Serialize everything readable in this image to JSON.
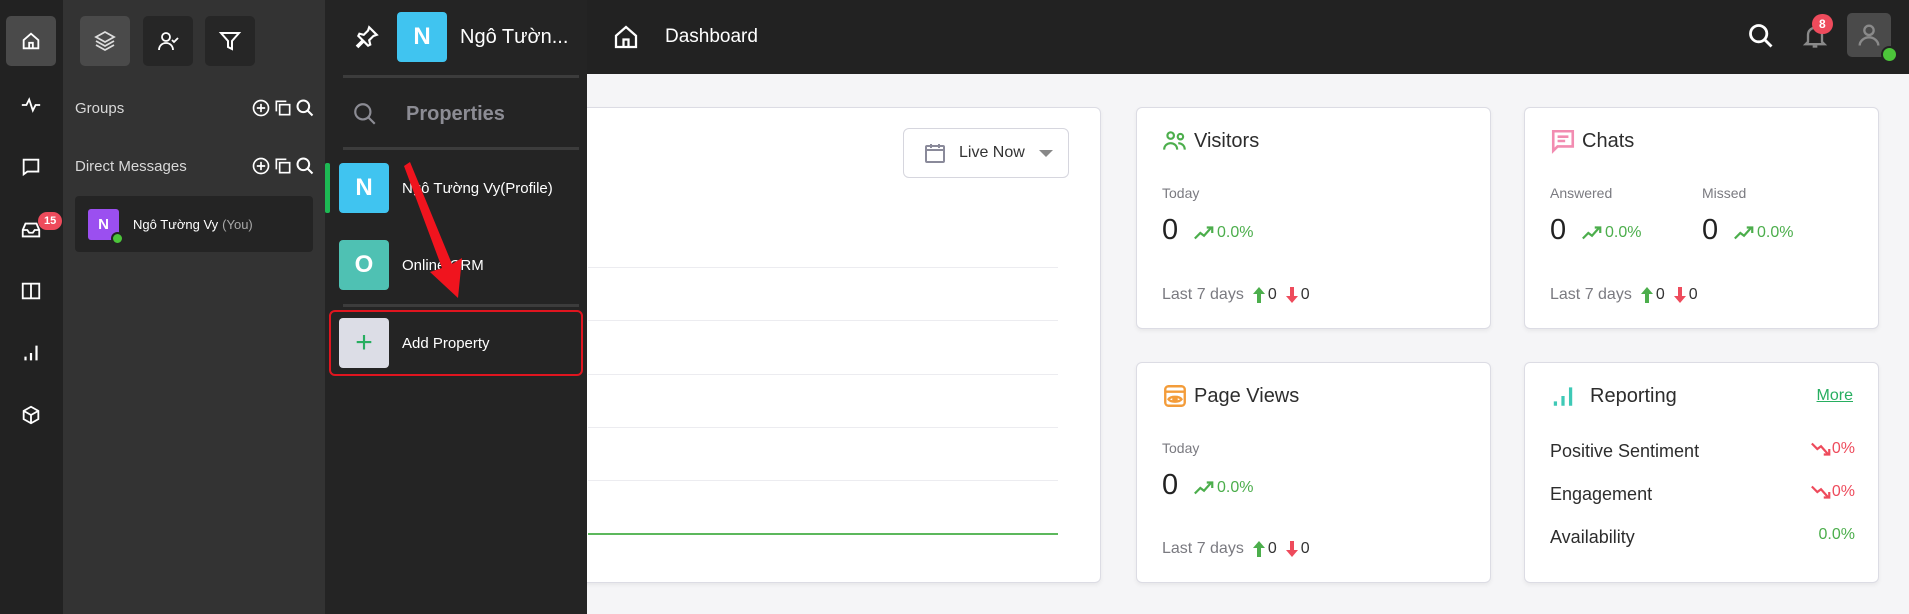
{
  "rail": {
    "items": [
      {
        "icon": "home-icon",
        "active": true
      },
      {
        "icon": "activity-icon"
      },
      {
        "icon": "chat-icon"
      },
      {
        "icon": "inbox-icon",
        "badge": "15"
      },
      {
        "icon": "book-icon"
      },
      {
        "icon": "bar-chart-icon"
      },
      {
        "icon": "package-icon"
      }
    ]
  },
  "panel": {
    "tools": [
      "layers-icon",
      "user-check-icon",
      "filter-icon"
    ],
    "groups_label": "Groups",
    "dm_label": "Direct Messages",
    "dm_item": {
      "initial": "N",
      "name": "Ngô Tường Vy",
      "suffix": "(You)"
    }
  },
  "popup": {
    "current": {
      "initial": "N",
      "name": "Ngô Tườn..."
    },
    "search_placeholder": "Properties",
    "properties": [
      {
        "initial": "N",
        "name": "Ngô Tường Vy(Profile)",
        "color": "#40c4f0",
        "selected": true
      },
      {
        "initial": "O",
        "name": "Online CRM",
        "color": "#4fc1b3",
        "selected": false
      }
    ],
    "add": {
      "symbol": "+",
      "label": "Add Property"
    }
  },
  "topbar": {
    "title": "Dashboard",
    "notifications_badge": "8"
  },
  "chart_card": {
    "range_label": "Live Now"
  },
  "visitors": {
    "title": "Visitors",
    "label": "Today",
    "value": "0",
    "trend": "0.0%",
    "last7_label": "Last 7 days",
    "up": "0",
    "down": "0"
  },
  "chats": {
    "title": "Chats",
    "answered_label": "Answered",
    "answered_value": "0",
    "answered_trend": "0.0%",
    "missed_label": "Missed",
    "missed_value": "0",
    "missed_trend": "0.0%",
    "last7_label": "Last 7 days",
    "up": "0",
    "down": "0"
  },
  "pageviews": {
    "title": "Page Views",
    "label": "Today",
    "value": "0",
    "trend": "0.0%",
    "last7_label": "Last 7 days",
    "up": "0",
    "down": "0"
  },
  "reporting": {
    "title": "Reporting",
    "more": "More",
    "rows": [
      {
        "label": "Positive Sentiment",
        "value": "0%",
        "trend": "down"
      },
      {
        "label": "Engagement",
        "value": "0%",
        "trend": "down"
      },
      {
        "label": "Availability",
        "value": "0.0%",
        "trend": "up"
      }
    ]
  },
  "colors": {
    "accent_green": "#4cae4c",
    "alert_red": "#ee4b5c",
    "highlight_border": "#e0151f"
  }
}
